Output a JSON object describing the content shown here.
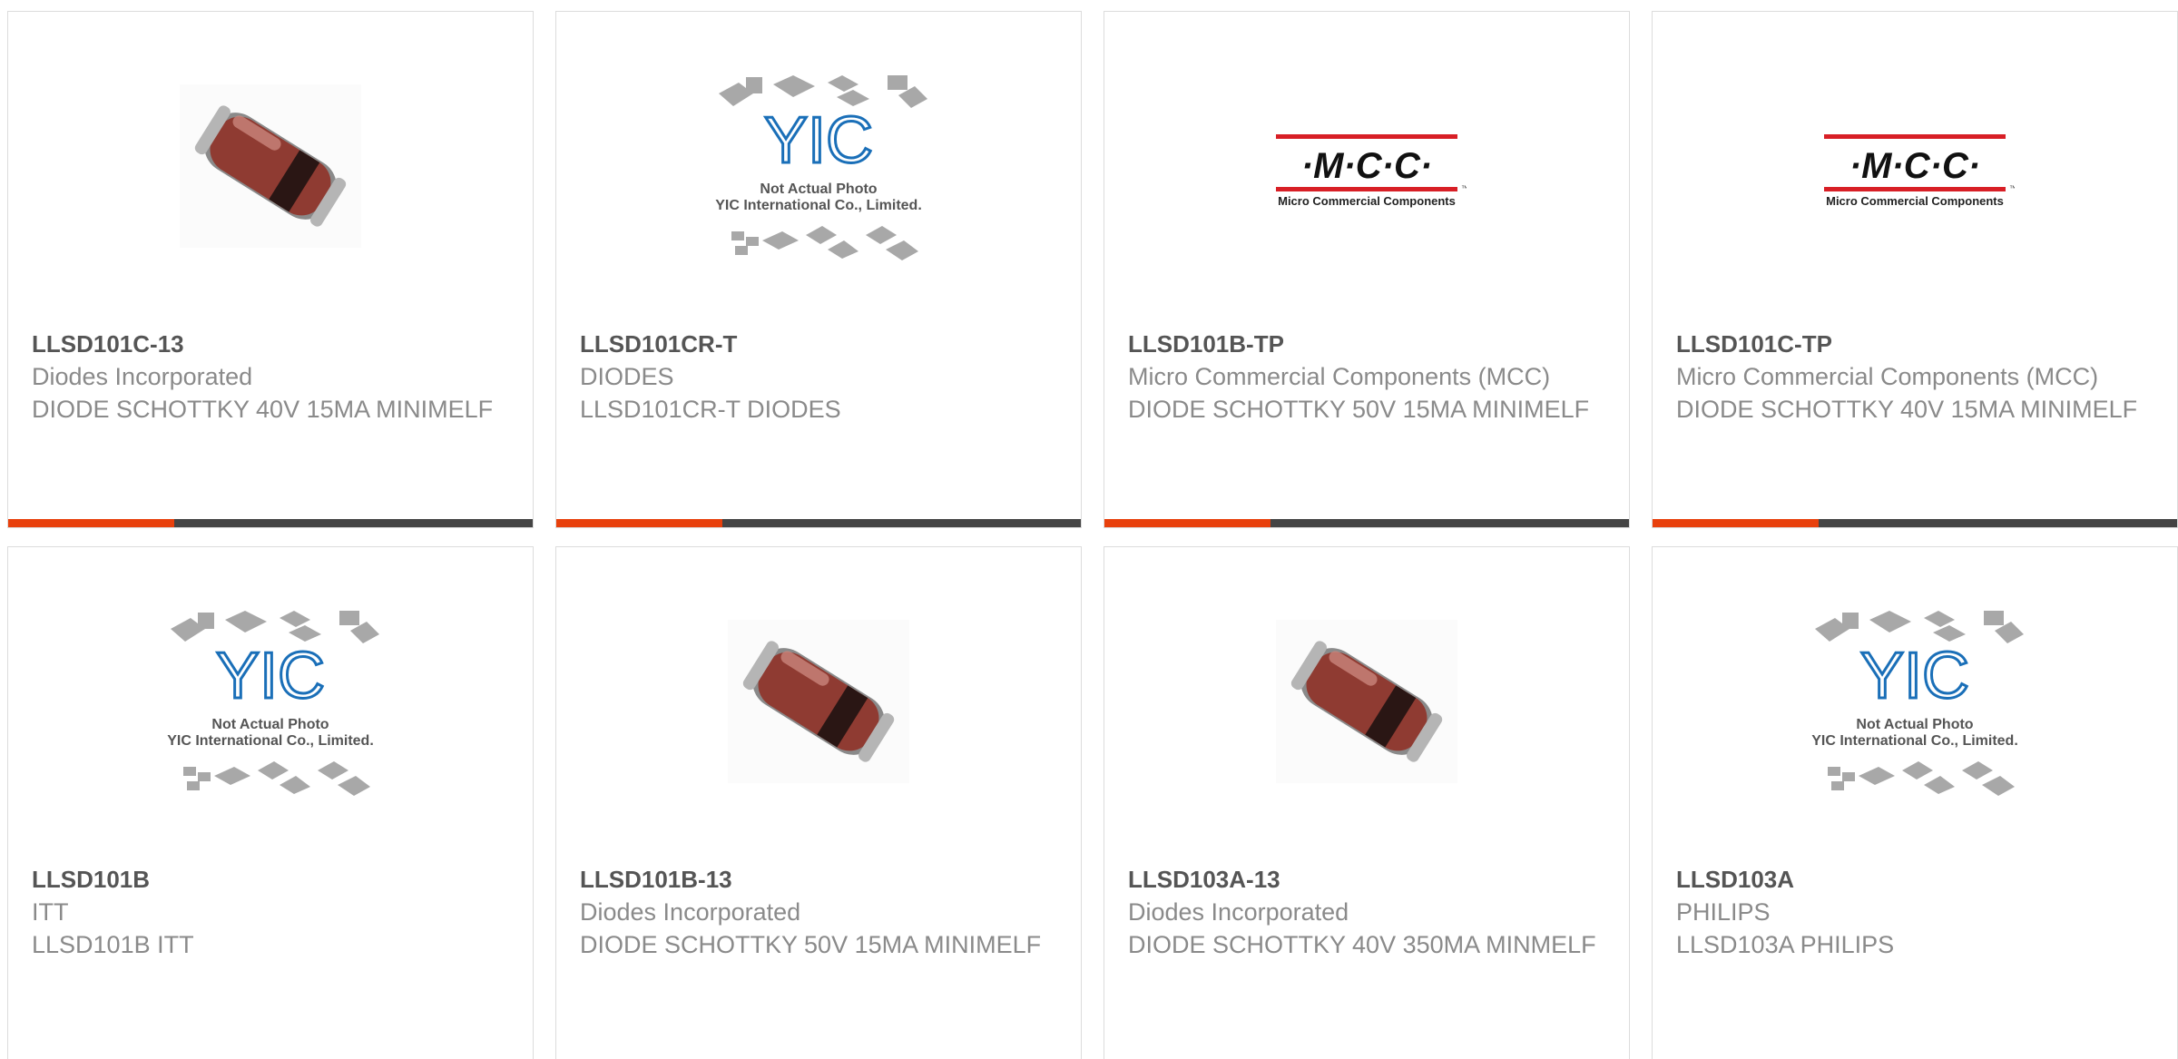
{
  "colors": {
    "accent": "#e8400c",
    "bar": "#444444",
    "part_number": "#555555",
    "text": "#8a8a8a",
    "mcc_red": "#d81f26"
  },
  "logos": {
    "mcc": {
      "mark": "·M·C·C·",
      "name": "Micro Commercial Components",
      "tm": "™"
    },
    "yic": {
      "mark": "YIC",
      "line1": "Not Actual Photo",
      "line2": "YIC International Co., Limited."
    }
  },
  "products": [
    {
      "image": "diode-photo",
      "part_number": "LLSD101C-13",
      "manufacturer": "Diodes Incorporated",
      "description": "DIODE SCHOTTKY 40V 15MA MINIMELF"
    },
    {
      "image": "yic-placeholder",
      "part_number": "LLSD101CR-T",
      "manufacturer": "DIODES",
      "description": "LLSD101CR-T DIODES"
    },
    {
      "image": "mcc-logo",
      "part_number": "LLSD101B-TP",
      "manufacturer": "Micro Commercial Components (MCC)",
      "description": "DIODE SCHOTTKY 50V 15MA MINIMELF"
    },
    {
      "image": "mcc-logo",
      "part_number": "LLSD101C-TP",
      "manufacturer": "Micro Commercial Components (MCC)",
      "description": "DIODE SCHOTTKY 40V 15MA MINIMELF"
    },
    {
      "image": "yic-placeholder",
      "part_number": "LLSD101B",
      "manufacturer": "ITT",
      "description": "LLSD101B ITT"
    },
    {
      "image": "diode-photo",
      "part_number": "LLSD101B-13",
      "manufacturer": "Diodes Incorporated",
      "description": "DIODE SCHOTTKY 50V 15MA MINIMELF"
    },
    {
      "image": "diode-photo",
      "part_number": "LLSD103A-13",
      "manufacturer": "Diodes Incorporated",
      "description": "DIODE SCHOTTKY 40V 350MA MINMELF"
    },
    {
      "image": "yic-placeholder",
      "part_number": "LLSD103A",
      "manufacturer": "PHILIPS",
      "description": "LLSD103A PHILIPS"
    }
  ]
}
